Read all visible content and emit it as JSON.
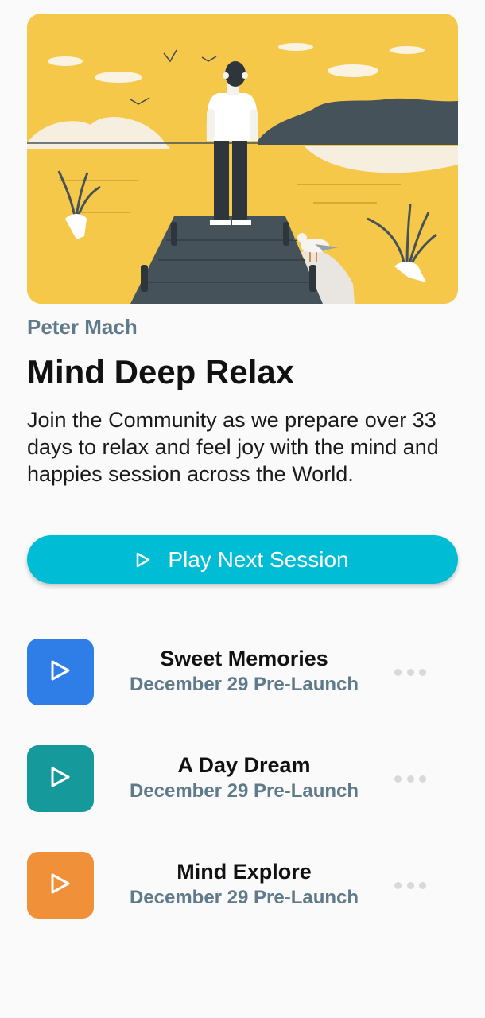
{
  "hero": {
    "icon": "meditation-pier-illustration"
  },
  "author": "Peter Mach",
  "title": "Mind Deep Relax",
  "description": "Join the Community as we prepare over 33 days to relax and feel joy with the mind and happies session across the World.",
  "play_button": {
    "label": "Play Next Session",
    "icon": "play-icon",
    "color": "#00bcd4"
  },
  "sessions": [
    {
      "title": "Sweet Memories",
      "subtitle": "December 29 Pre-Launch",
      "color": "#2f7ee8",
      "icon": "play-icon"
    },
    {
      "title": "A Day Dream",
      "subtitle": "December 29 Pre-Launch",
      "color": "#16999a",
      "icon": "play-icon"
    },
    {
      "title": "Mind Explore",
      "subtitle": "December 29 Pre-Launch",
      "color": "#f0913a",
      "icon": "play-icon"
    }
  ]
}
